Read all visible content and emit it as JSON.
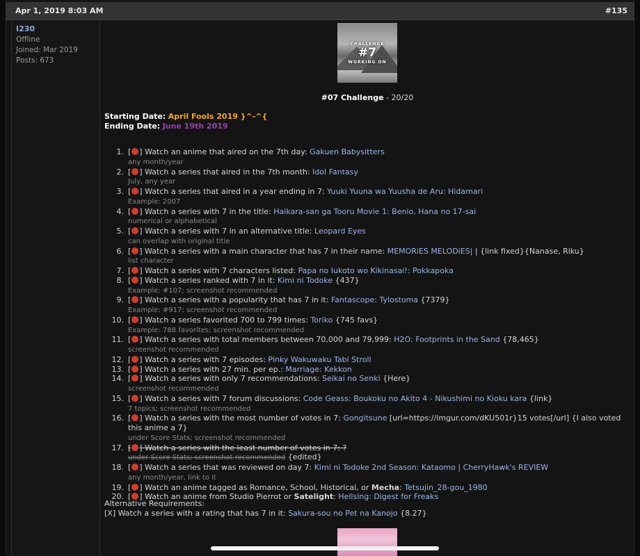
{
  "header": {
    "date": "Apr 1, 2019 8:03 AM",
    "post_number": "#135"
  },
  "user": {
    "name": "I230",
    "status": "Offline",
    "joined": "Joined: Mar 2019",
    "posts": "Posts: 673"
  },
  "banner": {
    "line1": "CHALLENGE",
    "line2": "#7",
    "line3": "WORKING ON"
  },
  "challenge": {
    "title": "#07 Challenge",
    "progress": " - 20/20"
  },
  "dates": {
    "start_label": "Starting Date:",
    "start_value": "April Fools 2019 }^-^{",
    "end_label": "Ending Date:",
    "end_value": "June 19th 2019"
  },
  "items": [
    {
      "num": "1.",
      "pre": "] Watch an anime that aired on the 7th day: ",
      "link": "Gakuen Babysitters",
      "post": "",
      "note": "any month/year"
    },
    {
      "num": "2.",
      "pre": "] Watch a series that aired in the 7th month: ",
      "link": "Idol Fantasy",
      "post": "",
      "note": "July, any year"
    },
    {
      "num": "3.",
      "pre": "] Watch a series that aired in a year ending in 7: ",
      "link": "Yuuki Yuuna wa Yuusha de Aru: Hidamari",
      "post": "",
      "note": "Example: 2007"
    },
    {
      "num": "4.",
      "pre": "] Watch a series with 7 in the title: ",
      "link": "Haikara-san ga Tooru Movie 1: Benio, Hana no 17-sai",
      "post": "",
      "note": "numerical or alphabetical"
    },
    {
      "num": "5.",
      "pre": "] Watch a series with 7 in an alternative title: ",
      "link": "Leopard Eyes",
      "post": "",
      "note": "can overlap with original title"
    },
    {
      "num": "6.",
      "pre": "] Watch a series with a main character that has 7 in their name: ",
      "link": "MEMORiES MELODiES|",
      "post": " | {link fixed}{Nanase, Riku}",
      "note": "list character"
    },
    {
      "num": "7.",
      "pre": "] Watch a series with 7 characters listed: ",
      "link": "Papa no Iukoto wo Kikinasai!: Pokkapoka",
      "post": "",
      "note": ""
    },
    {
      "num": "8.",
      "pre": "] Watch a series ranked with 7 in it: ",
      "link": "Kimi ni Todoke",
      "post": " {437}",
      "note": "Example: #107; screenshot recommended"
    },
    {
      "num": "9.",
      "pre": "] Watch a series with a popularity that has 7 in it: ",
      "link": "Fantascope: Tylostoma",
      "post": " {7379}",
      "note": "Example: #917; screenshot recommended"
    },
    {
      "num": "10.",
      "pre": "] Watch a series favorited 700 to 799 times: ",
      "link": "Toriko",
      "post": " {745 favs}",
      "note": "Example: 788 favorites; screenshot recommended"
    },
    {
      "num": "11.",
      "pre": "] Watch a series with total members between 70,000 and 79,999: ",
      "link": "H2O: Footprints in the Sand",
      "post": " {78,465}",
      "note": "screenshot recommended"
    },
    {
      "num": "12.",
      "pre": "] Watch a series with 7 episodes: ",
      "link": "Pinky Wakuwaku Tabi Stroll",
      "post": "",
      "note": ""
    },
    {
      "num": "13.",
      "pre": "] Watch a series with 27 min. per ep.: ",
      "link": "Marriage: Kekkon",
      "post": "",
      "note": ""
    },
    {
      "num": "14.",
      "pre": "] Watch a series with only 7 recommendations: ",
      "link": "Seikai no Senki",
      "post": " {Here}",
      "note": "screenshot recommended"
    },
    {
      "num": "15.",
      "pre": "] Watch a series with 7 forum discussions: ",
      "link": "Code Geass: Boukoku no Akito 4 - Nikushimi no Kioku kara",
      "post": " {link}",
      "note": "7 topics; screenshot recommended"
    },
    {
      "num": "16.",
      "pre": "] Watch a series with the most number of votes in 7: ",
      "link": "Gongitsune",
      "post": " [url=https://imgur.com/dKU501r}15 votes[/url] {I also voted this anime a 7}",
      "note": "under Score Stats; screenshot recommended"
    },
    {
      "num": "17.",
      "pre": "] Watch a series with the least number of votes in 7: ?",
      "link": "",
      "post": "",
      "note": "under Score Stats; screenshot recommended",
      "edited": " {edited}"
    },
    {
      "num": "18.",
      "pre": "] Watch a series that was reviewed on day 7: ",
      "link": "Kimi ni Todoke 2nd Season: Kataomo | CherryHawk's REVIEW",
      "post": "",
      "note": "any month/year, link to it"
    },
    {
      "num": "19.",
      "pre": "] Watch an anime tagged as Romance, School, Historical, or ",
      "bold": "Mecha",
      "pre2": ": ",
      "link": "Tetsujin_28-gou_1980",
      "post": "",
      "note": ""
    },
    {
      "num": "20.",
      "pre": "] Watch an anime from Studio Pierrot or ",
      "bold": "Satelight",
      "pre2": ": ",
      "link": "Hellsing: Digest for Freaks",
      "post": "",
      "note": ""
    }
  ],
  "alt": {
    "heading": "Alternative Requirements:",
    "line_pre": "[X] Watch a series with a rating that has 7 in it: ",
    "line_link": "Sakura-sou no Pet na Kanojo",
    "line_post": " {8.27}"
  },
  "colors": {
    "accent_orange": "#f5a623",
    "accent_purple": "#9b3fb0",
    "link": "#9bb5e8",
    "dot_red": "#d23c2a"
  }
}
